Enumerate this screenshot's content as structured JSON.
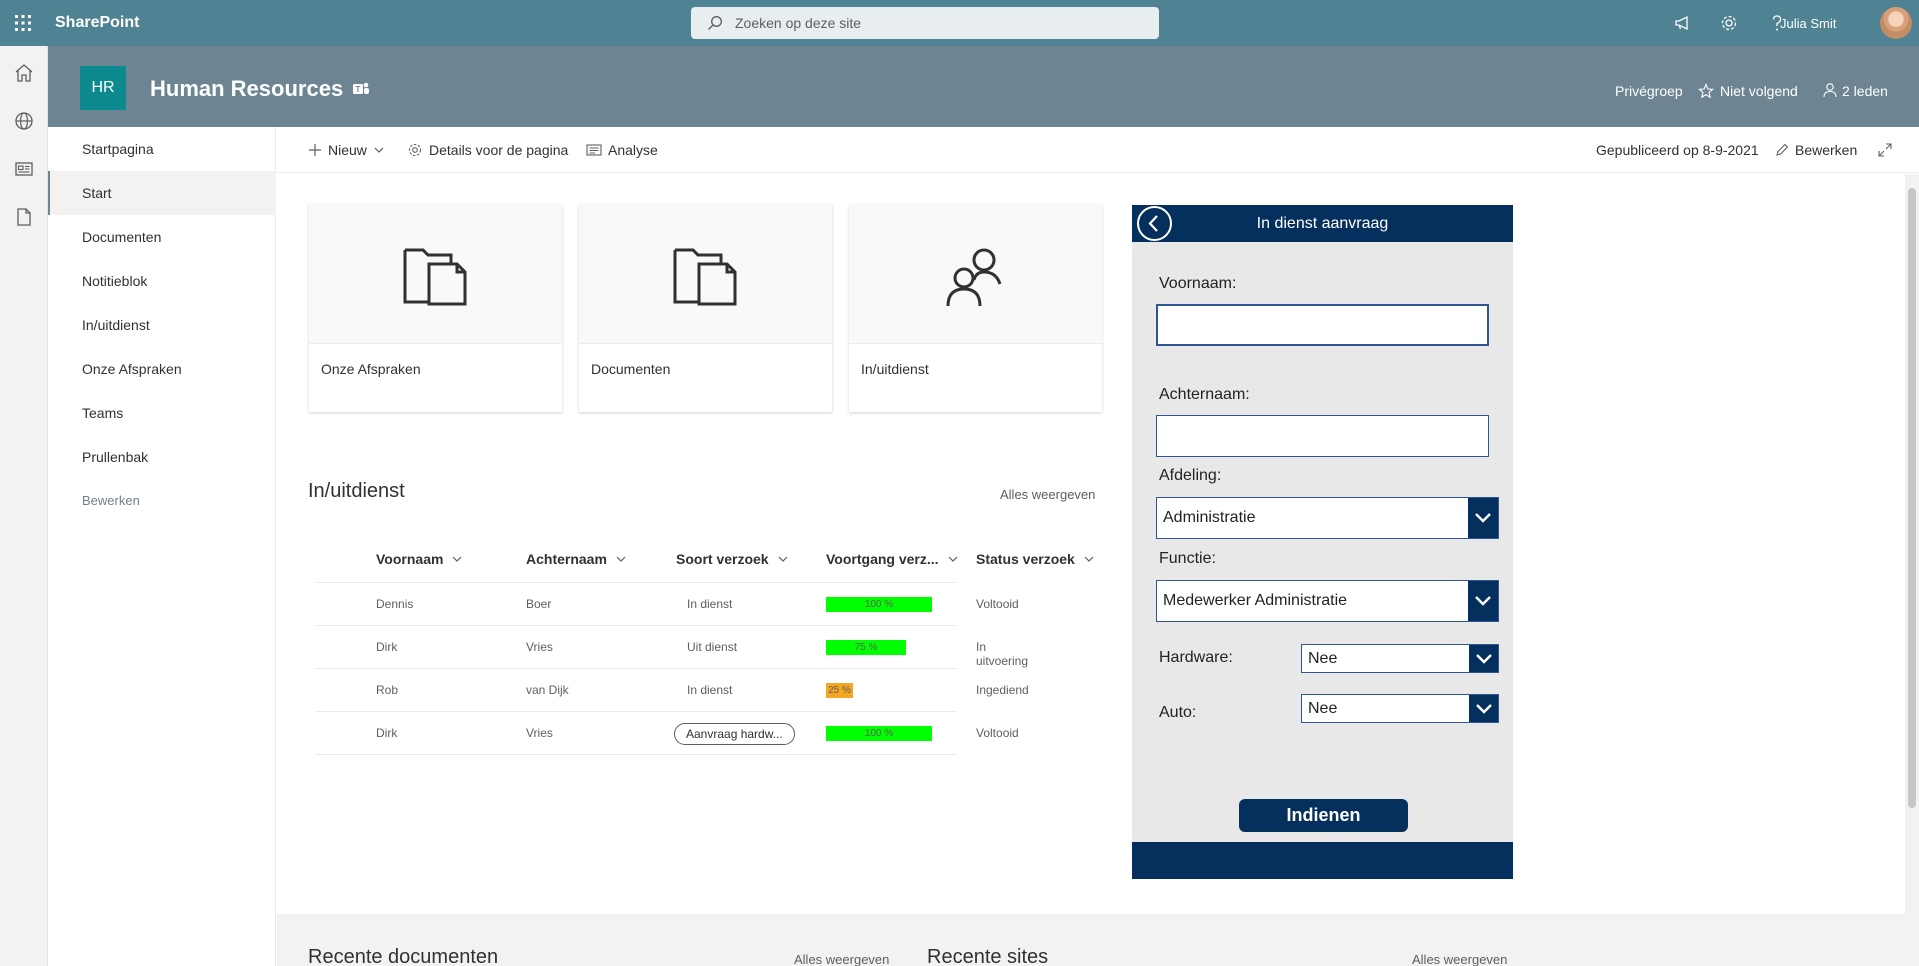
{
  "suitebar": {
    "app_name": "SharePoint",
    "search_placeholder": "Zoeken op deze site",
    "user_name": "Julia Smit",
    "icons": [
      "waffle-icon",
      "megaphone-icon",
      "gear-icon",
      "help-icon"
    ]
  },
  "site": {
    "logo_text": "HR",
    "title": "Human Resources",
    "privacy": "Privégroep",
    "follow": "Niet volgend",
    "members": "2 leden"
  },
  "nav": {
    "items": [
      "Startpagina",
      "Start",
      "Documenten",
      "Notitieblok",
      "In/uitdienst",
      "Onze Afspraken",
      "Teams",
      "Prullenbak"
    ],
    "active_index": 1,
    "edit": "Bewerken"
  },
  "commandbar": {
    "new": "Nieuw",
    "details": "Details voor de pagina",
    "analytics": "Analyse",
    "published": "Gepubliceerd op 8-9-2021",
    "edit": "Bewerken"
  },
  "quicklinks": [
    {
      "label": "Onze Afspraken",
      "icon": "folder-document-icon"
    },
    {
      "label": "Documenten",
      "icon": "folder-document-icon"
    },
    {
      "label": "In/uitdienst",
      "icon": "people-icon"
    }
  ],
  "list": {
    "title": "In/uitdienst",
    "show_all": "Alles weergeven",
    "columns": [
      "Voornaam",
      "Achternaam",
      "Soort verzoek",
      "Voortgang verz...",
      "Status verzoek"
    ],
    "rows": [
      {
        "voornaam": "Dennis",
        "achternaam": "Boer",
        "soort": "In dienst",
        "progress": 100,
        "progress_label": "100 %",
        "progress_color": "#00ff00",
        "status": "Voltooid",
        "pill": false
      },
      {
        "voornaam": "Dirk",
        "achternaam": "Vries",
        "soort": "Uit dienst",
        "progress": 75,
        "progress_label": "75 %",
        "progress_color": "#00ff00",
        "status": "In uitvoering",
        "pill": false
      },
      {
        "voornaam": "Rob",
        "achternaam": "van Dijk",
        "soort": "In dienst",
        "progress": 25,
        "progress_label": "25 %",
        "progress_color": "#f5a623",
        "status": "Ingediend",
        "pill": false
      },
      {
        "voornaam": "Dirk",
        "achternaam": "Vries",
        "soort": "Aanvraag hardw...",
        "progress": 100,
        "progress_label": "100 %",
        "progress_color": "#00ff00",
        "status": "Voltooid",
        "pill": true
      }
    ]
  },
  "form": {
    "title": "In dienst aanvraag",
    "voornaam_label": "Voornaam:",
    "voornaam_value": "",
    "achternaam_label": "Achternaam:",
    "achternaam_value": "",
    "afdeling_label": "Afdeling:",
    "afdeling_value": "Administratie",
    "functie_label": "Functie:",
    "functie_value": "Medewerker Administratie",
    "hardware_label": "Hardware:",
    "hardware_value": "Nee",
    "auto_label": "Auto:",
    "auto_value": "Nee",
    "submit": "Indienen",
    "accent_color": "#05305e"
  },
  "bottom": {
    "recent_docs": "Recente documenten",
    "recent_docs_all": "Alles weergeven",
    "recent_sites": "Recente sites",
    "recent_sites_all": "Alles weergeven"
  }
}
